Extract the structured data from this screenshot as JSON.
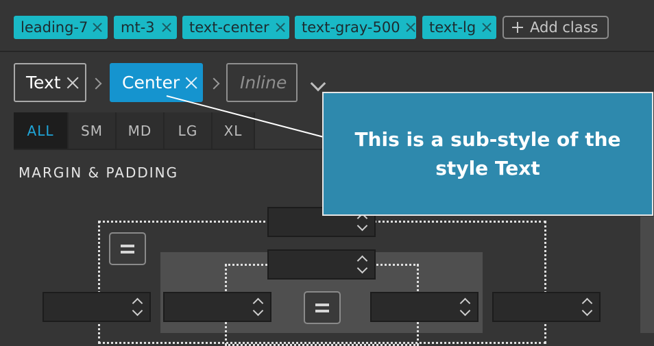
{
  "classes": [
    "leading-7",
    "mt-3",
    "text-center",
    "text-gray-500",
    "text-lg"
  ],
  "add_class_label": "Add class",
  "style_breadcrumb": {
    "base": "Text",
    "active": "Center",
    "placeholder": "Inline"
  },
  "breakpoints": [
    "ALL",
    "SM",
    "MD",
    "LG",
    "XL"
  ],
  "active_breakpoint": "ALL",
  "section_title": "MARGIN & PADDING",
  "tooltip": "This is a sub-style of the style Text",
  "colors": {
    "tag": "#19b9c6",
    "active_style": "#1594cf",
    "tooltip": "#2e89ad",
    "active_breakpoint": "#1fa5d8"
  }
}
